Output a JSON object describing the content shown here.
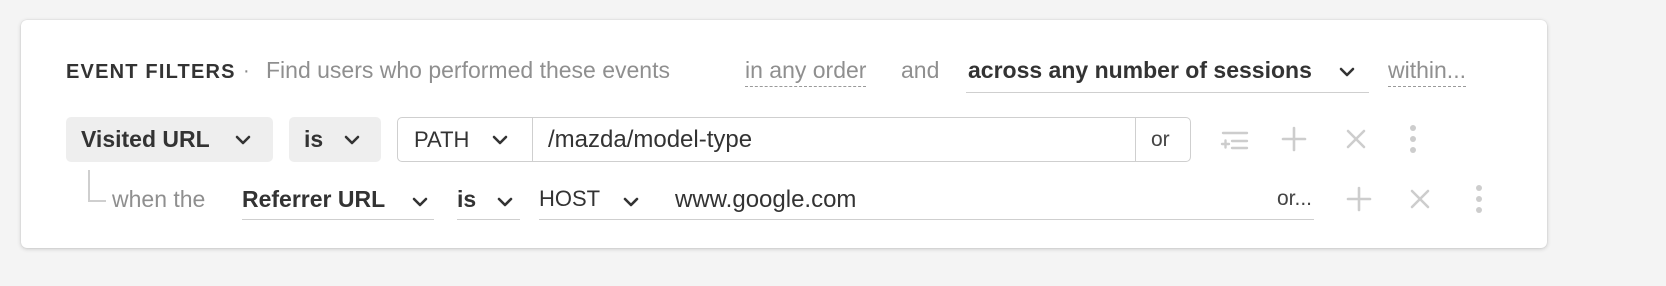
{
  "header": {
    "title": "EVENT FILTERS",
    "separator": "·",
    "description": "Find users who performed these events",
    "order_option": "in any order",
    "and_label": "and",
    "sessions_option": "across any number of sessions",
    "within_option": "within..."
  },
  "filter_row": {
    "event": "Visited URL",
    "operator": "is",
    "match_type": "PATH",
    "value": "/mazda/model-type",
    "or_label": "or",
    "icons": [
      "filter-add-icon",
      "plus-icon",
      "close-icon",
      "more-vertical-icon"
    ]
  },
  "sub_filter_row": {
    "connector": "when the",
    "property": "Referrer URL",
    "operator": "is",
    "match_type": "HOST",
    "value": "www.google.com",
    "or_label": "or...",
    "icons": [
      "plus-icon",
      "close-icon",
      "more-vertical-icon"
    ]
  },
  "colors": {
    "background": "#f4f4f4",
    "card": "#ffffff",
    "muted_text": "#8f8f8f",
    "pill": "#eeeeee",
    "border": "#cfcfcf",
    "disabled_icon": "#cdcdcd"
  }
}
